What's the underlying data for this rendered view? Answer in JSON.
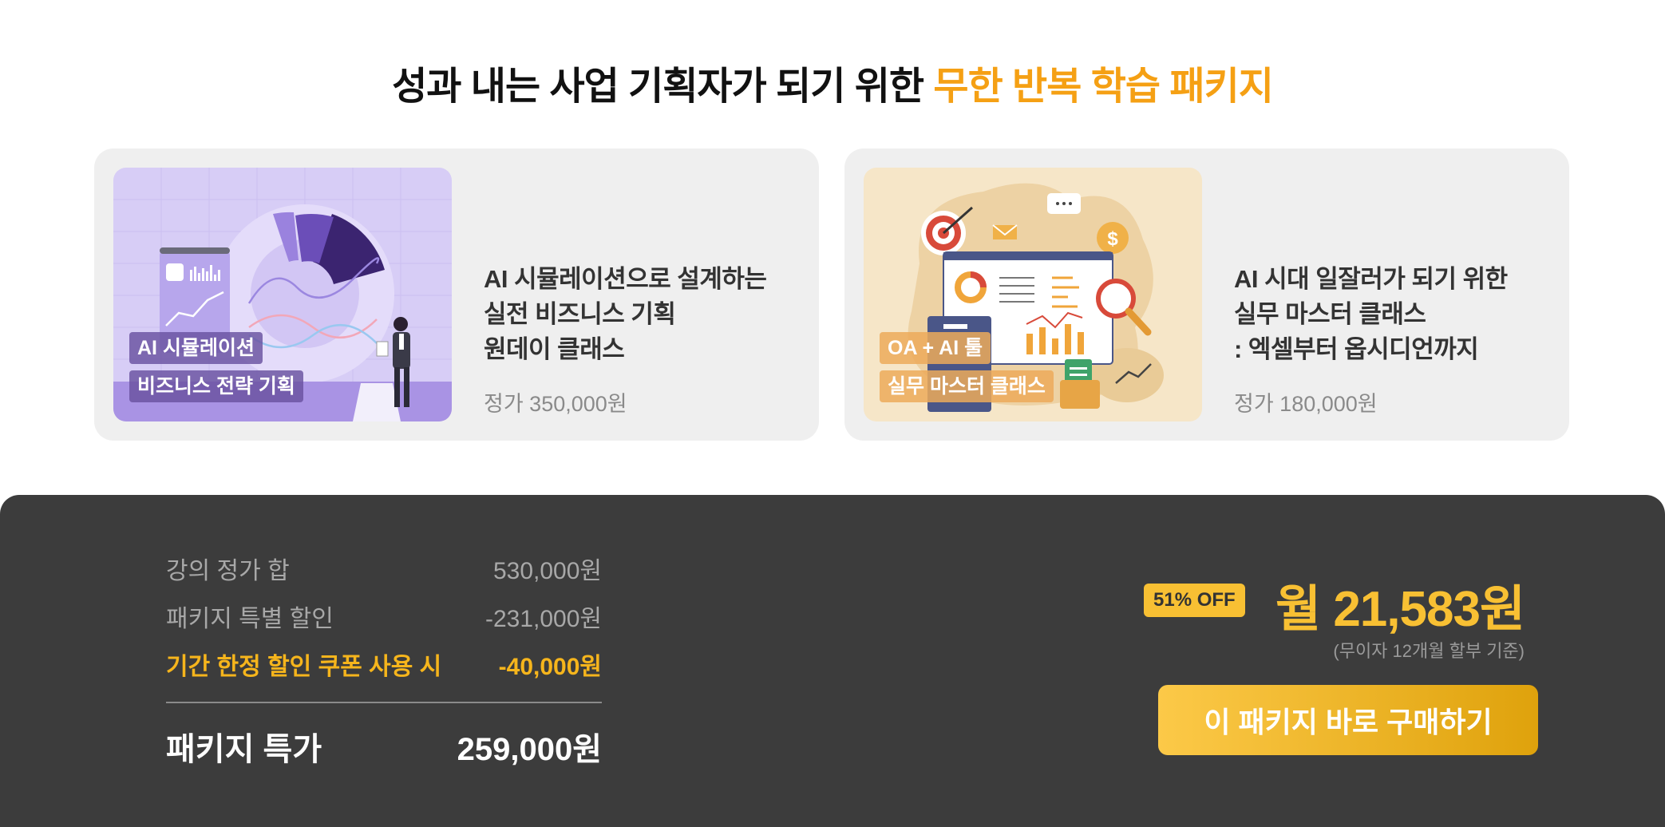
{
  "headline": {
    "main": "성과 내는 사업 기획자가 되기 위한",
    "accent": "무한 반복 학습 패키지"
  },
  "colors": {
    "accent": "#f5a014",
    "coupon": "#f6b51c",
    "panel_bg": "#3c3c3c",
    "button_start": "#fcc948",
    "button_end": "#dfa20c"
  },
  "courses": [
    {
      "tags": [
        "AI 시뮬레이션",
        "비즈니스 전략 기획"
      ],
      "title_lines": [
        "AI 시뮬레이션으로 설계하는",
        "실전 비즈니스 기획",
        "원데이 클래스"
      ],
      "price": "정가 350,000원",
      "illustration": "purple-business-analytics-illustration"
    },
    {
      "tags": [
        "OA + AI 툴",
        "실무 마스터 클래스"
      ],
      "title_lines": [
        "AI 시대 일잘러가 되기 위한",
        "실무 마스터 클래스",
        ": 엑셀부터 옵시디언까지"
      ],
      "price": "정가 180,000원",
      "illustration": "orange-office-dashboard-illustration"
    }
  ],
  "pricing": {
    "rows": [
      {
        "label": "강의 정가 합",
        "value": "530,000원"
      },
      {
        "label": "패키지 특별 할인",
        "value": "-231,000원"
      },
      {
        "label": "기간 한정 할인 쿠폰 사용 시",
        "value": "-40,000원"
      }
    ],
    "total": {
      "label": "패키지 특가",
      "value": "259,000원"
    },
    "off_badge": "51% OFF",
    "monthly": "월 21,583원",
    "monthly_note": "(무이자 12개월 할부 기준)",
    "buy_label": "이 패키지 바로 구매하기"
  }
}
